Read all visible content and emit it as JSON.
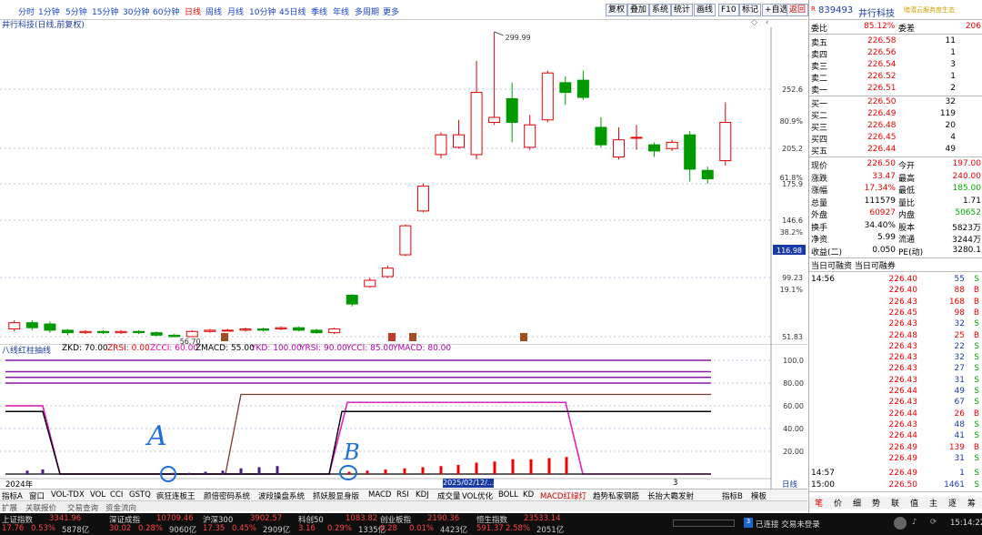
{
  "toolbar": {
    "periods": [
      "分时",
      "1分钟",
      "5分钟",
      "15分钟",
      "30分钟",
      "60分钟",
      "日线",
      "周线",
      "月线",
      "10分钟",
      "45日线",
      "季线",
      "年线",
      "多周期",
      "更多"
    ],
    "active_period": "日线",
    "right_buttons": [
      "复权",
      "叠加",
      "系统",
      "统计",
      "画线",
      "F10",
      "标记",
      "+自选",
      "返回"
    ]
  },
  "chart": {
    "title": "井行科技(日线,前复权)",
    "price_levels": [
      "252.6",
      "205.2",
      "175.9",
      "146.6",
      "99.23",
      "51.83"
    ],
    "pct_levels": [
      "80.9%",
      "61.8%",
      "38.2%",
      "19.1%"
    ],
    "current_price_tag": "116.98",
    "high_label": "299.99",
    "low_label": "56.70"
  },
  "chart_data": {
    "type": "candlestick",
    "title": "井行科技(日线,前复权)",
    "candles": [
      {
        "o": 58,
        "c": 63,
        "h": 65,
        "l": 56
      },
      {
        "o": 63,
        "c": 59,
        "h": 65,
        "l": 57
      },
      {
        "o": 62,
        "c": 57,
        "h": 64,
        "l": 55
      },
      {
        "o": 57,
        "c": 55,
        "h": 58,
        "l": 53
      },
      {
        "o": 55,
        "c": 56,
        "h": 57,
        "l": 54
      },
      {
        "o": 56,
        "c": 55,
        "h": 57,
        "l": 54
      },
      {
        "o": 55,
        "c": 56,
        "h": 57,
        "l": 54
      },
      {
        "o": 56,
        "c": 55,
        "h": 57,
        "l": 54
      },
      {
        "o": 55,
        "c": 53,
        "h": 56,
        "l": 52
      },
      {
        "o": 53,
        "c": 51,
        "h": 54,
        "l": 50
      },
      {
        "o": 51,
        "c": 56,
        "h": 57,
        "l": 50
      },
      {
        "o": 56,
        "c": 57,
        "h": 58,
        "l": 55
      },
      {
        "o": 57,
        "c": 57,
        "h": 58,
        "l": 56
      },
      {
        "o": 57,
        "c": 58,
        "h": 59,
        "l": 56
      },
      {
        "o": 58,
        "c": 57,
        "h": 59,
        "l": 56
      },
      {
        "o": 58,
        "c": 59,
        "h": 60,
        "l": 57
      },
      {
        "o": 59,
        "c": 57,
        "h": 60,
        "l": 56
      },
      {
        "o": 57,
        "c": 55,
        "h": 58,
        "l": 54
      },
      {
        "o": 55,
        "c": 58,
        "h": 59,
        "l": 54
      },
      {
        "o": 85,
        "c": 78,
        "h": 86,
        "l": 76
      },
      {
        "o": 92,
        "c": 97,
        "h": 99,
        "l": 91
      },
      {
        "o": 100,
        "c": 107,
        "h": 109,
        "l": 99
      },
      {
        "o": 118,
        "c": 142,
        "h": 143,
        "l": 117
      },
      {
        "o": 154,
        "c": 174,
        "h": 176,
        "l": 153
      },
      {
        "o": 200,
        "c": 216,
        "h": 218,
        "l": 197
      },
      {
        "o": 206,
        "c": 216,
        "h": 228,
        "l": 205
      },
      {
        "o": 200,
        "c": 250,
        "h": 276,
        "l": 196
      },
      {
        "o": 226,
        "c": 230,
        "h": 299.99,
        "l": 224
      },
      {
        "o": 245,
        "c": 226,
        "h": 258,
        "l": 210
      },
      {
        "o": 206,
        "c": 224,
        "h": 232,
        "l": 204
      },
      {
        "o": 228,
        "c": 266,
        "h": 268,
        "l": 226
      },
      {
        "o": 258,
        "c": 250,
        "h": 263,
        "l": 240
      },
      {
        "o": 260,
        "c": 246,
        "h": 268,
        "l": 244
      },
      {
        "o": 222,
        "c": 208,
        "h": 230,
        "l": 206
      },
      {
        "o": 198,
        "c": 212,
        "h": 222,
        "l": 196
      },
      {
        "o": 214,
        "c": 214,
        "h": 224,
        "l": 204
      },
      {
        "o": 208,
        "c": 203,
        "h": 210,
        "l": 198
      },
      {
        "o": 205,
        "c": 210,
        "h": 212,
        "l": 203
      },
      {
        "o": 216,
        "c": 188,
        "h": 219,
        "l": 178
      },
      {
        "o": 187,
        "c": 180,
        "h": 190,
        "l": 176
      },
      {
        "o": 195,
        "c": 226,
        "h": 242,
        "l": 191
      }
    ],
    "ylim": [
      51.83,
      252.6
    ],
    "y_tick_labels": [
      "252.6",
      "205.2",
      "175.9",
      "146.6",
      "99.23",
      "51.83"
    ],
    "pct_tick_labels": [
      "80.9%",
      "61.8%",
      "38.2%",
      "19.1%"
    ],
    "high_label": "299.99",
    "low_label": "56.70"
  },
  "indicator": {
    "name": "八线红柱抽线",
    "params": [
      {
        "label": "ZKD: 70.00",
        "color": "#000"
      },
      {
        "label": "ZRSI: 0.00",
        "color": "#e00"
      },
      {
        "label": "ZCCI: 60.00",
        "color": "#e0a"
      },
      {
        "label": "ZMACD: 55.00",
        "color": "#000"
      },
      {
        "label": "YKD: 100.00",
        "color": "#a0a"
      },
      {
        "label": "YRSI: 90.00",
        "color": "#a0a"
      },
      {
        "label": "YCCI: 85.00",
        "color": "#a0a"
      },
      {
        "label": "YMACD: 80.00",
        "color": "#a0a"
      }
    ],
    "yticks": [
      "100.0",
      "80.00",
      "60.00",
      "40.00",
      "20.00"
    ],
    "annotation_a": "A",
    "annotation_b": "B",
    "date_left": "2024年",
    "date_mid": "2025/02/12/...",
    "date_right": "3",
    "ri_label": "日线"
  },
  "indicator_tabs": [
    "指标A",
    "窗口",
    "VOL-TDX",
    "VOL",
    "CCI",
    "GSTQ",
    "疯狂连板王",
    "颜倍密码系统",
    "波段操盘系统",
    "抓妖股显身版",
    "MACD",
    "RSI",
    "KDJ",
    "成交量",
    "VOL优化",
    "BOLL",
    "KD",
    "MACD红绿灯",
    "趋势私家钢筋",
    "长抬大霸发射",
    "指标B",
    "模板"
  ],
  "func_tabs": [
    "扩展",
    "关联报价",
    "交易查询",
    "资金流向"
  ],
  "right_panel": {
    "code": "839493",
    "name": "井行科技",
    "subtitle": "暗潜云服务度生态",
    "weibi_label": "委比",
    "weibi_value": "85.12%",
    "weicha_label": "委差",
    "weicha_value": "206",
    "asks": [
      {
        "label": "卖五",
        "price": "226.58",
        "vol": "11"
      },
      {
        "label": "卖四",
        "price": "226.56",
        "vol": "1"
      },
      {
        "label": "卖三",
        "price": "226.54",
        "vol": "3"
      },
      {
        "label": "卖二",
        "price": "226.52",
        "vol": "1"
      },
      {
        "label": "卖一",
        "price": "226.51",
        "vol": "2"
      }
    ],
    "bids": [
      {
        "label": "买一",
        "price": "226.50",
        "vol": "32"
      },
      {
        "label": "买二",
        "price": "226.49",
        "vol": "119"
      },
      {
        "label": "买三",
        "price": "226.48",
        "vol": "20"
      },
      {
        "label": "买四",
        "price": "226.45",
        "vol": "4"
      },
      {
        "label": "买五",
        "price": "226.44",
        "vol": "49"
      }
    ],
    "stats": [
      {
        "l1": "现价",
        "v1": "226.50",
        "l2": "今开",
        "v2": "197.00"
      },
      {
        "l1": "涨跌",
        "v1": "33.47",
        "l2": "最高",
        "v2": "240.00"
      },
      {
        "l1": "涨幅",
        "v1": "17.34%",
        "l2": "最低",
        "v2": "185.00"
      },
      {
        "l1": "总量",
        "v1": "111579",
        "l2": "量比",
        "v2": "1.71"
      },
      {
        "l1": "外盘",
        "v1": "60927",
        "l2": "内盘",
        "v2": "50652"
      },
      {
        "l1": "换手",
        "v1": "34.40%",
        "l2": "股本",
        "v2": "5823万"
      },
      {
        "l1": "净资",
        "v1": "5.99",
        "l2": "流通",
        "v2": "3244万"
      },
      {
        "l1": "收益(二)",
        "v1": "0.050",
        "l2": "PE(动)",
        "v2": "3280.1"
      }
    ],
    "rongzi": "当日可融资 当日可融券",
    "ticks": [
      {
        "t": "14:56",
        "p": "226.40",
        "v": "55",
        "d": "S"
      },
      {
        "t": "",
        "p": "226.40",
        "v": "88",
        "d": "B"
      },
      {
        "t": "",
        "p": "226.43",
        "v": "168",
        "d": "B"
      },
      {
        "t": "",
        "p": "226.45",
        "v": "98",
        "d": "B"
      },
      {
        "t": "",
        "p": "226.43",
        "v": "32",
        "d": "S"
      },
      {
        "t": "",
        "p": "226.48",
        "v": "25",
        "d": "B"
      },
      {
        "t": "",
        "p": "226.43",
        "v": "22",
        "d": "S"
      },
      {
        "t": "",
        "p": "226.43",
        "v": "32",
        "d": "S"
      },
      {
        "t": "",
        "p": "226.43",
        "v": "27",
        "d": "S"
      },
      {
        "t": "",
        "p": "226.43",
        "v": "31",
        "d": "S"
      },
      {
        "t": "",
        "p": "226.44",
        "v": "49",
        "d": "S"
      },
      {
        "t": "",
        "p": "226.43",
        "v": "67",
        "d": "S"
      },
      {
        "t": "",
        "p": "226.44",
        "v": "26",
        "d": "B"
      },
      {
        "t": "",
        "p": "226.43",
        "v": "48",
        "d": "S"
      },
      {
        "t": "",
        "p": "226.44",
        "v": "41",
        "d": "S"
      },
      {
        "t": "",
        "p": "226.49",
        "v": "139",
        "d": "B"
      },
      {
        "t": "",
        "p": "226.49",
        "v": "31",
        "d": "S"
      },
      {
        "t": "14:57",
        "p": "226.49",
        "v": "1",
        "d": "S"
      },
      {
        "t": "15:00",
        "p": "226.50",
        "v": "1461",
        "d": "S"
      }
    ],
    "bottom_tabs": [
      "笔",
      "价",
      "细",
      "势",
      "联",
      "值",
      "主",
      "逐",
      "筹"
    ]
  },
  "statusbar": {
    "indices": [
      {
        "name": "上证指数",
        "value": "3341.96",
        "chg": "17.76",
        "pct": "0.53%",
        "amt": "5878亿"
      },
      {
        "name": "深证成指",
        "value": "10709.46",
        "chg": "30.02",
        "pct": "0.28%",
        "amt": "9060亿"
      },
      {
        "name": "沪深300",
        "value": "3902.57",
        "chg": "17.35",
        "pct": "0.45%",
        "amt": "2909亿"
      },
      {
        "name": "科创50",
        "value": "1083.82",
        "chg": "3.16",
        "pct": "0.29%",
        "amt": "1335亿"
      },
      {
        "name": "创业板指",
        "value": "2190.36",
        "chg": "0.28",
        "pct": "0.01%",
        "amt": "4423亿"
      },
      {
        "name": "恒生指数",
        "value": "23533.14",
        "chg": "591.37",
        "pct": "2.58%",
        "amt": "2051亿"
      }
    ],
    "connection": "已连接 交易未登录",
    "time": "15:14:22"
  },
  "colors": {
    "up": "#e00000",
    "down": "#009900",
    "accent": "#1a3aa6"
  }
}
